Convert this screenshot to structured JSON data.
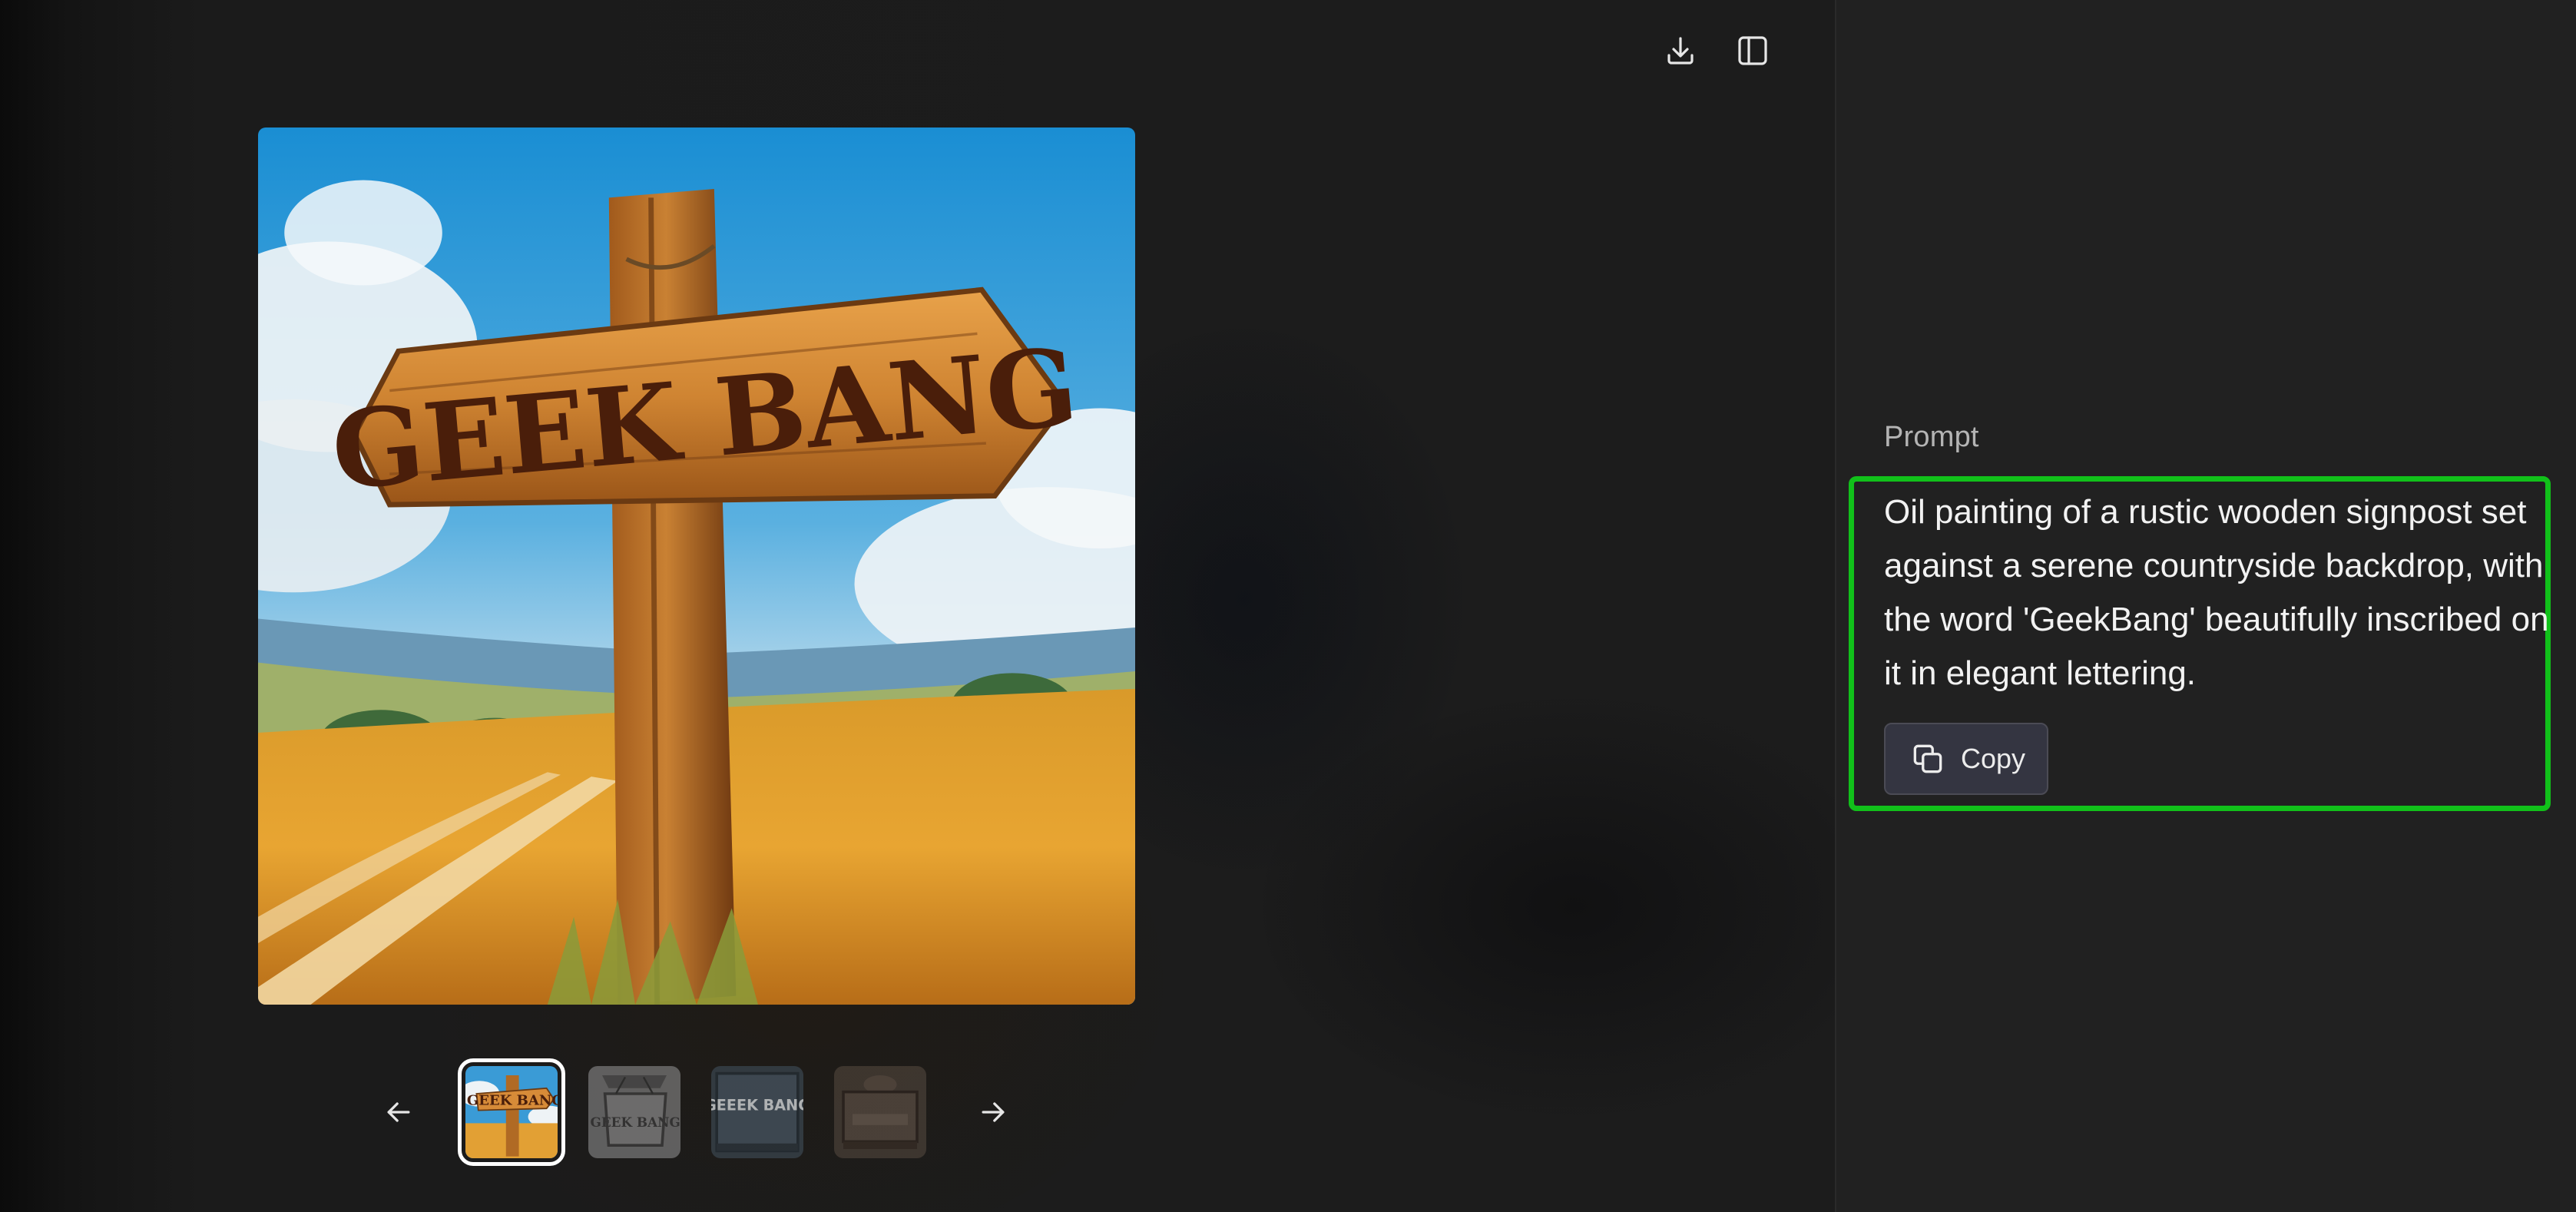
{
  "toolbar": {
    "download_icon": "download-icon",
    "sidebar_toggle_icon": "sidebar-toggle-icon"
  },
  "main_image": {
    "sign_text": "GEEK BANG"
  },
  "thumbnails": {
    "count": 4,
    "selected_index": 0,
    "items": [
      {
        "sign_text": "GEEK BANG"
      },
      {
        "sign_text": "GEEK BANG"
      },
      {
        "sign_text": "GEEEK BANG"
      },
      {
        "sign_text": ""
      }
    ]
  },
  "navigation": {
    "prev_icon": "arrow-left-icon",
    "next_icon": "arrow-right-icon"
  },
  "side_panel": {
    "prompt_label": "Prompt",
    "prompt_text": "Oil painting of a rustic wooden signpost set against a serene countryside backdrop, with the word 'GeekBang' beautifully inscribed on it in elegant lettering.",
    "copy_label": "Copy",
    "copy_icon": "copy-icon"
  },
  "colors": {
    "highlight_border": "#11c11a",
    "panel_background": "#212121",
    "viewer_background": "#1c1c1c"
  }
}
